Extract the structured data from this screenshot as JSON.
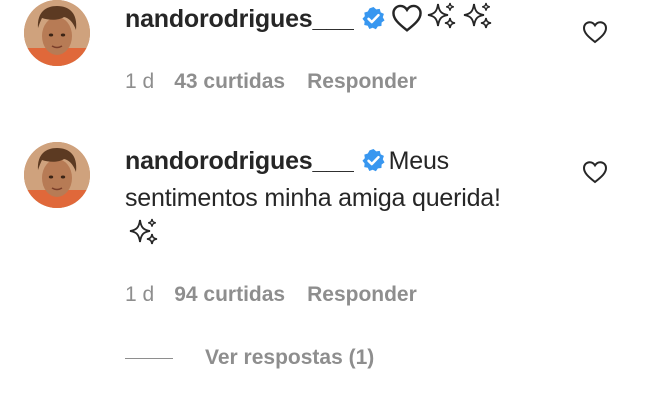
{
  "comments": [
    {
      "username": "nandorodrigues___",
      "text": "",
      "emoji_icons": [
        "white-heart-icon",
        "sparkles-icon",
        "sparkles-icon"
      ],
      "time": "1 d",
      "likes": "43 curtidas",
      "reply_label": "Responder"
    },
    {
      "username": "nandorodrigues___",
      "text": "Meus sentimentos minha amiga querida!",
      "emoji_icons": [
        "sparkles-icon"
      ],
      "time": "1 d",
      "likes": "94 curtidas",
      "reply_label": "Responder"
    }
  ],
  "view_replies": "Ver respostas (1)",
  "colors": {
    "verified_blue": "#3897f0",
    "meta_gray": "#8e8e8e",
    "text": "#262626"
  }
}
